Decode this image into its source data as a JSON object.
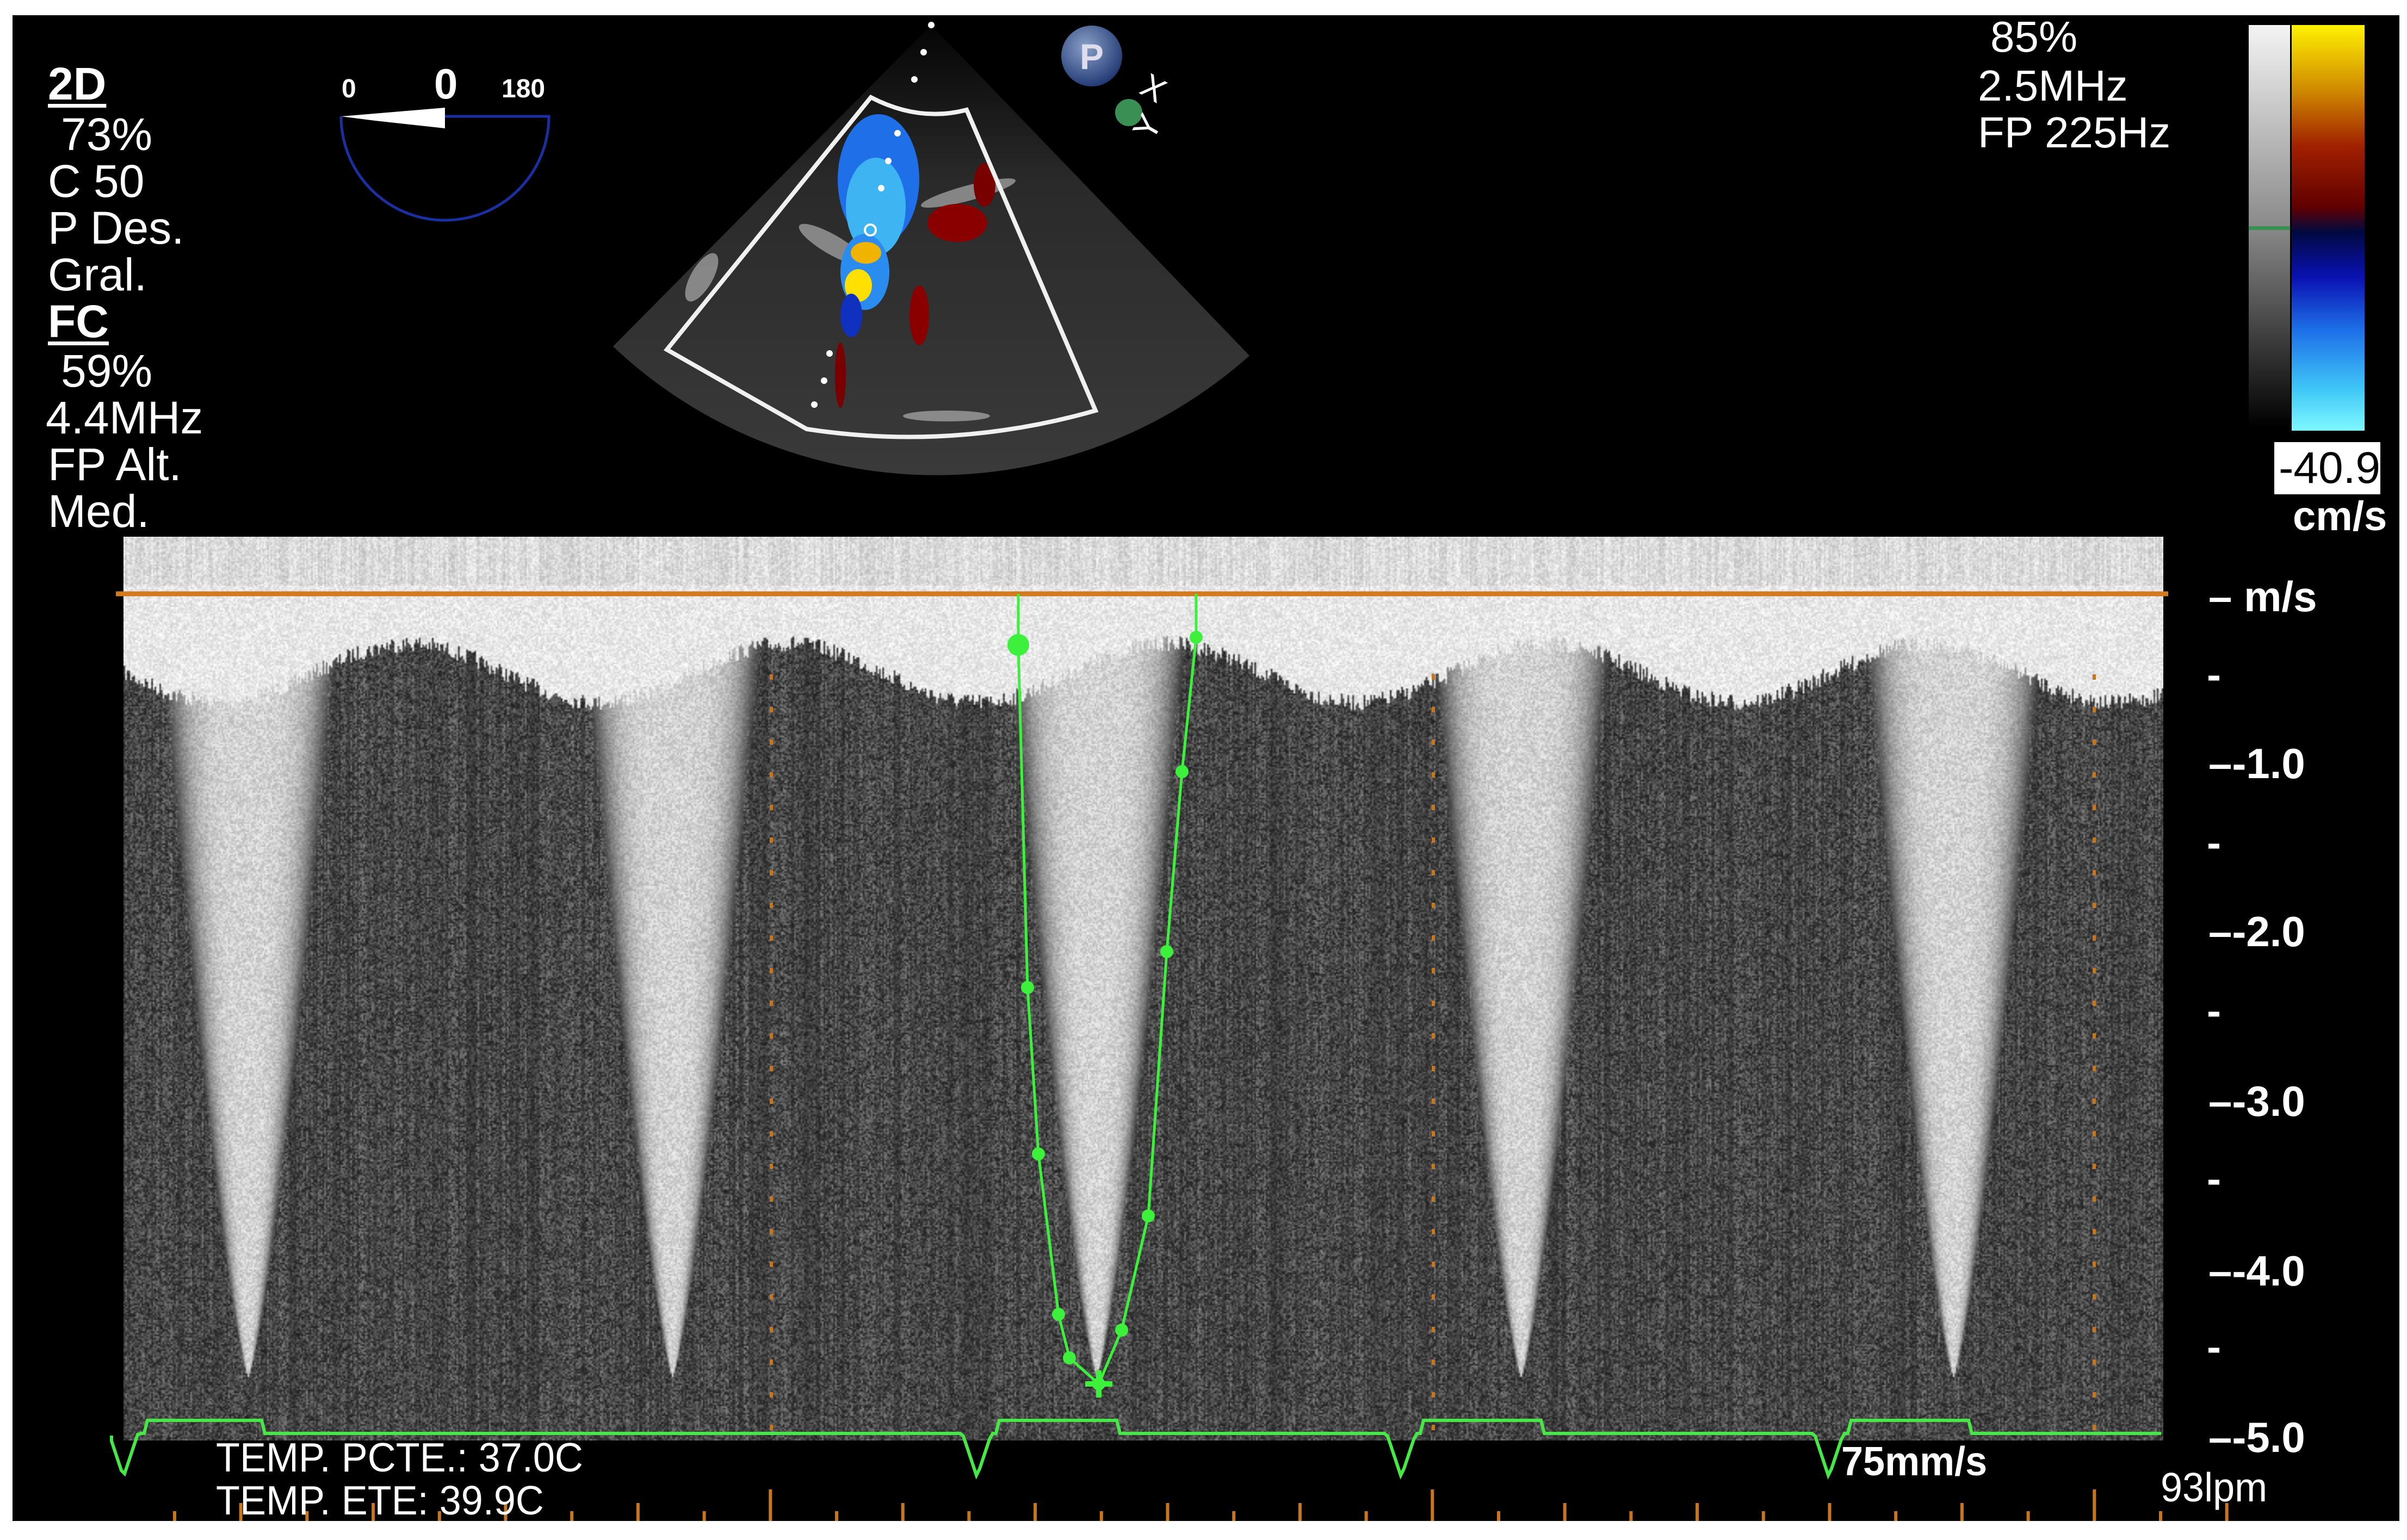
{
  "left_panel": {
    "mode_2d": "2D",
    "gain_2d": "73%",
    "compression": "C 50",
    "persistence": "P Des.",
    "map": "Gral.",
    "mode_color": "FC",
    "gain_color": "59%",
    "frequency": "4.4MHz",
    "filter": "FP Alt.",
    "filter_level": "Med."
  },
  "angle_indicator": {
    "min": "0",
    "value": "0",
    "max": "180"
  },
  "probe_badge": {
    "letter": "P",
    "x_label": "X",
    "y_label": "Y"
  },
  "top_right": {
    "gain": "85%",
    "frequency": "2.5MHz",
    "filter": "FP 225Hz"
  },
  "color_scale": {
    "value": "-40.9",
    "unit": "cm/s"
  },
  "velocity_axis": {
    "unit": "m/s",
    "ticks": [
      "-1.0",
      "-2.0",
      "-3.0",
      "-4.0",
      "-5.0"
    ]
  },
  "footer": {
    "temp_patient": "TEMP. PCTE.: 37.0C",
    "temp_probe": "TEMP. ETE: 39.9C",
    "sweep_speed": "75mm/s",
    "heart_rate": "93lpm"
  },
  "colors": {
    "background": "#000000",
    "baseline": "#d27a1e",
    "trace": "#3cf03c",
    "ecg": "#46e846",
    "angle_arc": "#1a2fa0",
    "timing_ticks": "#c8761e"
  }
}
